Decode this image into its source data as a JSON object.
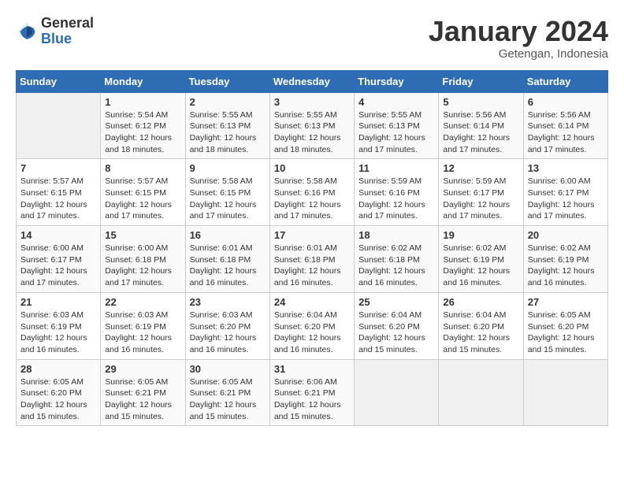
{
  "header": {
    "logo_general": "General",
    "logo_blue": "Blue",
    "month_title": "January 2024",
    "subtitle": "Getengan, Indonesia"
  },
  "days_of_week": [
    "Sunday",
    "Monday",
    "Tuesday",
    "Wednesday",
    "Thursday",
    "Friday",
    "Saturday"
  ],
  "weeks": [
    [
      {
        "day": "",
        "info": ""
      },
      {
        "day": "1",
        "info": "Sunrise: 5:54 AM\nSunset: 6:12 PM\nDaylight: 12 hours\nand 18 minutes."
      },
      {
        "day": "2",
        "info": "Sunrise: 5:55 AM\nSunset: 6:13 PM\nDaylight: 12 hours\nand 18 minutes."
      },
      {
        "day": "3",
        "info": "Sunrise: 5:55 AM\nSunset: 6:13 PM\nDaylight: 12 hours\nand 18 minutes."
      },
      {
        "day": "4",
        "info": "Sunrise: 5:55 AM\nSunset: 6:13 PM\nDaylight: 12 hours\nand 17 minutes."
      },
      {
        "day": "5",
        "info": "Sunrise: 5:56 AM\nSunset: 6:14 PM\nDaylight: 12 hours\nand 17 minutes."
      },
      {
        "day": "6",
        "info": "Sunrise: 5:56 AM\nSunset: 6:14 PM\nDaylight: 12 hours\nand 17 minutes."
      }
    ],
    [
      {
        "day": "7",
        "info": "Sunrise: 5:57 AM\nSunset: 6:15 PM\nDaylight: 12 hours\nand 17 minutes."
      },
      {
        "day": "8",
        "info": "Sunrise: 5:57 AM\nSunset: 6:15 PM\nDaylight: 12 hours\nand 17 minutes."
      },
      {
        "day": "9",
        "info": "Sunrise: 5:58 AM\nSunset: 6:15 PM\nDaylight: 12 hours\nand 17 minutes."
      },
      {
        "day": "10",
        "info": "Sunrise: 5:58 AM\nSunset: 6:16 PM\nDaylight: 12 hours\nand 17 minutes."
      },
      {
        "day": "11",
        "info": "Sunrise: 5:59 AM\nSunset: 6:16 PM\nDaylight: 12 hours\nand 17 minutes."
      },
      {
        "day": "12",
        "info": "Sunrise: 5:59 AM\nSunset: 6:17 PM\nDaylight: 12 hours\nand 17 minutes."
      },
      {
        "day": "13",
        "info": "Sunrise: 6:00 AM\nSunset: 6:17 PM\nDaylight: 12 hours\nand 17 minutes."
      }
    ],
    [
      {
        "day": "14",
        "info": "Sunrise: 6:00 AM\nSunset: 6:17 PM\nDaylight: 12 hours\nand 17 minutes."
      },
      {
        "day": "15",
        "info": "Sunrise: 6:00 AM\nSunset: 6:18 PM\nDaylight: 12 hours\nand 17 minutes."
      },
      {
        "day": "16",
        "info": "Sunrise: 6:01 AM\nSunset: 6:18 PM\nDaylight: 12 hours\nand 16 minutes."
      },
      {
        "day": "17",
        "info": "Sunrise: 6:01 AM\nSunset: 6:18 PM\nDaylight: 12 hours\nand 16 minutes."
      },
      {
        "day": "18",
        "info": "Sunrise: 6:02 AM\nSunset: 6:18 PM\nDaylight: 12 hours\nand 16 minutes."
      },
      {
        "day": "19",
        "info": "Sunrise: 6:02 AM\nSunset: 6:19 PM\nDaylight: 12 hours\nand 16 minutes."
      },
      {
        "day": "20",
        "info": "Sunrise: 6:02 AM\nSunset: 6:19 PM\nDaylight: 12 hours\nand 16 minutes."
      }
    ],
    [
      {
        "day": "21",
        "info": "Sunrise: 6:03 AM\nSunset: 6:19 PM\nDaylight: 12 hours\nand 16 minutes."
      },
      {
        "day": "22",
        "info": "Sunrise: 6:03 AM\nSunset: 6:19 PM\nDaylight: 12 hours\nand 16 minutes."
      },
      {
        "day": "23",
        "info": "Sunrise: 6:03 AM\nSunset: 6:20 PM\nDaylight: 12 hours\nand 16 minutes."
      },
      {
        "day": "24",
        "info": "Sunrise: 6:04 AM\nSunset: 6:20 PM\nDaylight: 12 hours\nand 16 minutes."
      },
      {
        "day": "25",
        "info": "Sunrise: 6:04 AM\nSunset: 6:20 PM\nDaylight: 12 hours\nand 15 minutes."
      },
      {
        "day": "26",
        "info": "Sunrise: 6:04 AM\nSunset: 6:20 PM\nDaylight: 12 hours\nand 15 minutes."
      },
      {
        "day": "27",
        "info": "Sunrise: 6:05 AM\nSunset: 6:20 PM\nDaylight: 12 hours\nand 15 minutes."
      }
    ],
    [
      {
        "day": "28",
        "info": "Sunrise: 6:05 AM\nSunset: 6:20 PM\nDaylight: 12 hours\nand 15 minutes."
      },
      {
        "day": "29",
        "info": "Sunrise: 6:05 AM\nSunset: 6:21 PM\nDaylight: 12 hours\nand 15 minutes."
      },
      {
        "day": "30",
        "info": "Sunrise: 6:05 AM\nSunset: 6:21 PM\nDaylight: 12 hours\nand 15 minutes."
      },
      {
        "day": "31",
        "info": "Sunrise: 6:06 AM\nSunset: 6:21 PM\nDaylight: 12 hours\nand 15 minutes."
      },
      {
        "day": "",
        "info": ""
      },
      {
        "day": "",
        "info": ""
      },
      {
        "day": "",
        "info": ""
      }
    ]
  ]
}
